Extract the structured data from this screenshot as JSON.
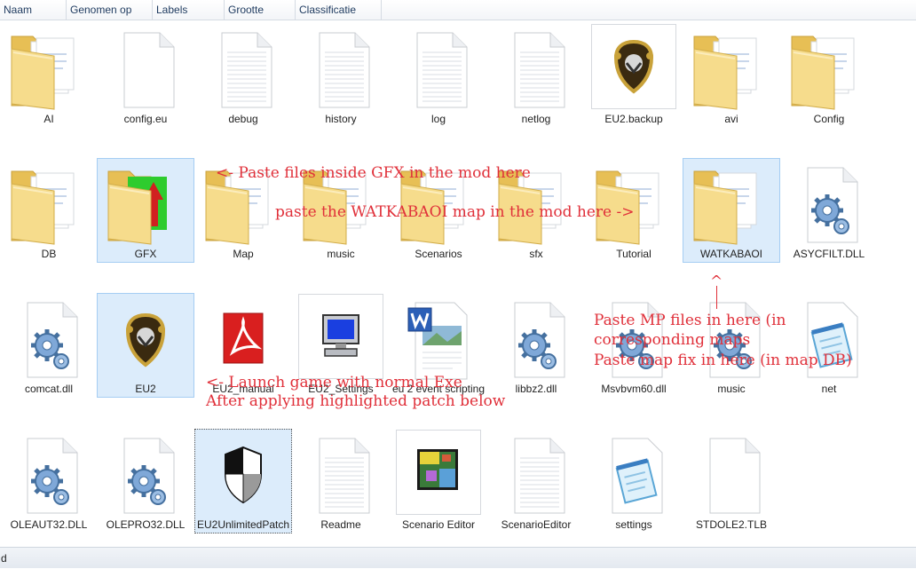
{
  "columns": [
    "Naam",
    "Genomen op",
    "Labels",
    "Grootte",
    "Classificatie"
  ],
  "rows": [
    [
      {
        "label": "AI",
        "type": "folder"
      },
      {
        "label": "config.eu",
        "type": "blank"
      },
      {
        "label": "debug",
        "type": "text"
      },
      {
        "label": "history",
        "type": "text"
      },
      {
        "label": "log",
        "type": "text"
      },
      {
        "label": "netlog",
        "type": "text"
      },
      {
        "label": "EU2.backup",
        "type": "shield",
        "framed": true
      },
      {
        "label": "avi",
        "type": "folder"
      },
      {
        "label": "Config",
        "type": "folder"
      }
    ],
    [
      {
        "label": "DB",
        "type": "folder"
      },
      {
        "label": "GFX",
        "type": "folder-gfx",
        "selected": true
      },
      {
        "label": "Map",
        "type": "folder"
      },
      {
        "label": "music",
        "type": "folder"
      },
      {
        "label": "Scenarios",
        "type": "folder"
      },
      {
        "label": "sfx",
        "type": "folder"
      },
      {
        "label": "Tutorial",
        "type": "folder"
      },
      {
        "label": "WATKABAOI",
        "type": "folder",
        "selected": true
      },
      {
        "label": "ASYCFILT.DLL",
        "type": "gear"
      }
    ],
    [
      {
        "label": "comcat.dll",
        "type": "gear"
      },
      {
        "label": "EU2",
        "type": "shield",
        "selected": true
      },
      {
        "label": "EU2_manual",
        "type": "pdf"
      },
      {
        "label": "EU2_Settings",
        "type": "computer",
        "framed": true
      },
      {
        "label": "eu 2 event scripting",
        "type": "word"
      },
      {
        "label": "libbz2.dll",
        "type": "gear"
      },
      {
        "label": "Msvbvm60.dll",
        "type": "gear"
      },
      {
        "label": "music",
        "type": "gear"
      },
      {
        "label": "net",
        "type": "notepad"
      }
    ],
    [
      {
        "label": "OLEAUT32.DLL",
        "type": "gear"
      },
      {
        "label": "OLEPRO32.DLL",
        "type": "gear"
      },
      {
        "label": "EU2UnlimitedPatch",
        "type": "patch",
        "selected": true,
        "focused": true
      },
      {
        "label": "Readme",
        "type": "text"
      },
      {
        "label": "Scenario Editor",
        "type": "map",
        "framed": true
      },
      {
        "label": "ScenarioEditor",
        "type": "text"
      },
      {
        "label": "settings",
        "type": "notepad"
      },
      {
        "label": "STDOLE2.TLB",
        "type": "blank"
      }
    ]
  ],
  "annotations": {
    "gfx": "<- Paste files inside GFX in the mod here",
    "watkabaoi": "paste the WATKABAOI map in the mod here ->",
    "caret": "^",
    "mp_line1": "Paste MP files in here (in",
    "mp_line2": "corresponding maps",
    "mp_line3": "Paste map fix in here (in map DB)",
    "launch_line1": "<- Launch game with normal Exe",
    "launch_line2": "After applying highlighted patch below"
  },
  "status": {
    "text": "d"
  },
  "colors": {
    "annotation": "#e0303a",
    "selection": "#dcecfb",
    "folder": "#f3d67e"
  }
}
